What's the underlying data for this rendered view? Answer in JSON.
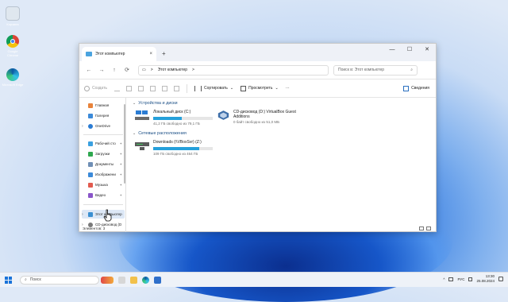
{
  "desktop": {
    "icons": [
      {
        "label": "Корзина"
      },
      {
        "label": "Google Chrome"
      },
      {
        "label": "Microsoft Edge"
      }
    ]
  },
  "window": {
    "tab_title": "Этот компьютер",
    "tab_close": "×",
    "new_tab": "+",
    "controls": {
      "minimize": "—",
      "maximize": "☐",
      "close": "✕"
    },
    "nav": {
      "back": "←",
      "forward": "→",
      "up": "↑",
      "refresh": "⟳"
    },
    "address": {
      "monitor": "▭",
      "sep": ">",
      "location": "Этот компьютер",
      "sep2": ">"
    },
    "search": {
      "placeholder": "Поиск в: Этот компьютер",
      "icon": "⌕"
    },
    "toolbar": {
      "create": "Создать",
      "sort": "Сортировать",
      "view": "Просмотреть",
      "more": "···",
      "details": "Сведения"
    },
    "sidebar": {
      "items": [
        {
          "label": "Главная",
          "color": "#e8833a"
        },
        {
          "label": "Галерея",
          "color": "#3b8ad9"
        },
        {
          "label": "OneDrive",
          "color": "#2b7cd3"
        },
        {
          "label": "Рабочий сто",
          "color": "#3aa0e0"
        },
        {
          "label": "Загрузки",
          "color": "#2fa84f"
        },
        {
          "label": "Документы",
          "color": "#6f8fb5"
        },
        {
          "label": "Изображени",
          "color": "#3b8ad9"
        },
        {
          "label": "Музыка",
          "color": "#e25b4f"
        },
        {
          "label": "Видео",
          "color": "#8a55c9"
        },
        {
          "label": "Этот компьютер",
          "color": "#3a8fd1"
        },
        {
          "label": "CD-дисковод (D",
          "color": "#7a7a7a"
        }
      ],
      "pin": "✦"
    },
    "groups": {
      "devices": "Устройства и диски",
      "network": "Сетевые расположения"
    },
    "drives": [
      {
        "name": "Локальный диск (C:)",
        "free": "41,2 ГБ свободно из 79,1 ГБ",
        "used": 0.48
      },
      {
        "name": "CD-дисковод (D:) VirtualBox Guest Additions",
        "free": "0 байт свободно из 51,0 МБ",
        "used": 1.0
      },
      {
        "name": "Downloads (\\\\VBoxSvr) (Z:)",
        "free": "109 ГБ свободно из 464 ГБ",
        "used": 0.77
      }
    ],
    "status": {
      "items": "Элементов: 3"
    }
  },
  "taskbar": {
    "search": "Поиск",
    "tray": {
      "chevron": "^",
      "lang": "РУС",
      "time": "13:30",
      "date": "25.08.2024"
    }
  }
}
